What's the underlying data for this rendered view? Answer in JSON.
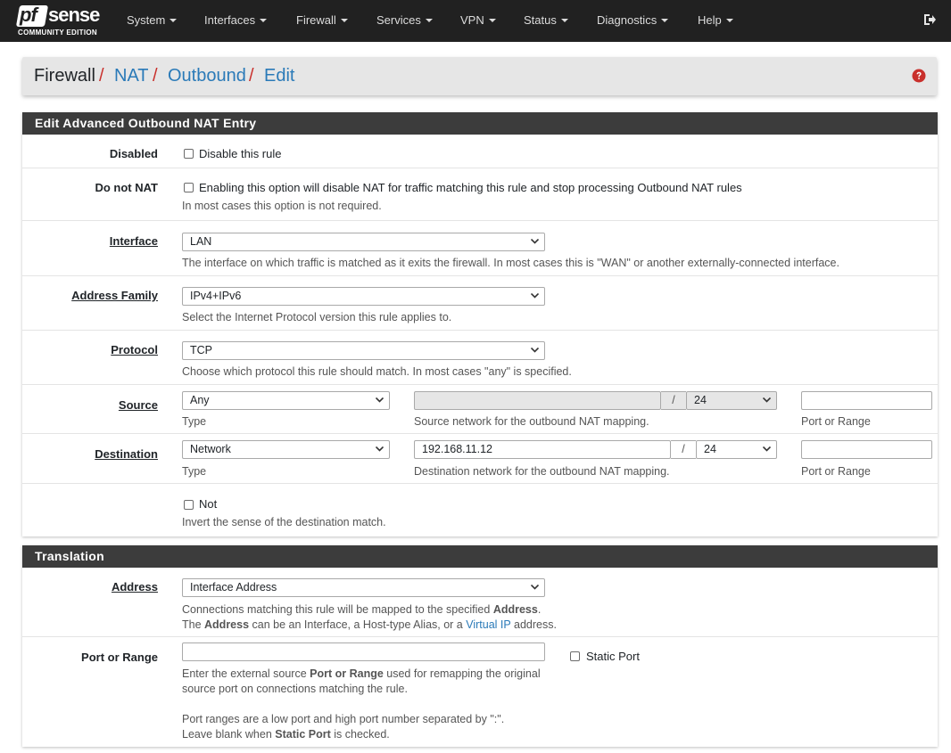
{
  "brand": {
    "logo_pf": "pf",
    "logo_sense": "sense",
    "logo_sub": "COMMUNITY EDITION"
  },
  "nav": [
    "System",
    "Interfaces",
    "Firewall",
    "Services",
    "VPN",
    "Status",
    "Diagnostics",
    "Help"
  ],
  "breadcrumb": {
    "firewall": "Firewall",
    "nat": "NAT",
    "outbound": "Outbound",
    "edit": "Edit",
    "sep": "/"
  },
  "panel_main": {
    "title": "Edit Advanced Outbound NAT Entry",
    "disabled": {
      "label": "Disabled",
      "checkbox_text": "Disable this rule"
    },
    "donotnat": {
      "label": "Do not NAT",
      "checkbox_text": "Enabling this option will disable NAT for traffic matching this rule and stop processing Outbound NAT rules",
      "help": "In most cases this option is not required."
    },
    "interface": {
      "label": "Interface",
      "value": "LAN",
      "help": "The interface on which traffic is matched as it exits the firewall. In most cases this is \"WAN\" or another externally-connected interface."
    },
    "address_family": {
      "label": "Address Family",
      "value": "IPv4+IPv6",
      "help": "Select the Internet Protocol version this rule applies to."
    },
    "protocol": {
      "label": "Protocol",
      "value": "TCP",
      "help": "Choose which protocol this rule should match. In most cases \"any\" is specified."
    },
    "source": {
      "label": "Source",
      "type_value": "Any",
      "type_help": "Type",
      "network_value": "",
      "mask": "24",
      "slash": "/",
      "network_help": "Source network for the outbound NAT mapping.",
      "port_value": "",
      "port_help": "Port or Range"
    },
    "destination": {
      "label": "Destination",
      "type_value": "Network",
      "type_help": "Type",
      "network_value": "192.168.11.12",
      "mask": "24",
      "slash": "/",
      "network_help": "Destination network for the outbound NAT mapping.",
      "port_value": "",
      "port_help": "Port or Range"
    },
    "not": {
      "checkbox_text": "Not",
      "help": "Invert the sense of the destination match."
    }
  },
  "panel_translation": {
    "title": "Translation",
    "address": {
      "label": "Address",
      "value": "Interface Address",
      "help1_pre": "Connections matching this rule will be mapped to the specified ",
      "help1_bold": "Address",
      "help1_post": ".",
      "help2_pre": "The ",
      "help2_bold": "Address",
      "help2_mid": " can be an Interface, a Host-type Alias, or a ",
      "help2_link": "Virtual IP",
      "help2_post": " address."
    },
    "port": {
      "label": "Port or Range",
      "value": "",
      "static_port": "Static Port",
      "help1_pre": "Enter the external source ",
      "help1_bold": "Port or Range",
      "help1_post": " used for remapping the original",
      "help2": "source port on connections matching the rule.",
      "help3": "Port ranges are a low port and high port number separated by \":\".",
      "help4_pre": "Leave blank when ",
      "help4_bold": "Static Port",
      "help4_post": " is checked."
    }
  }
}
